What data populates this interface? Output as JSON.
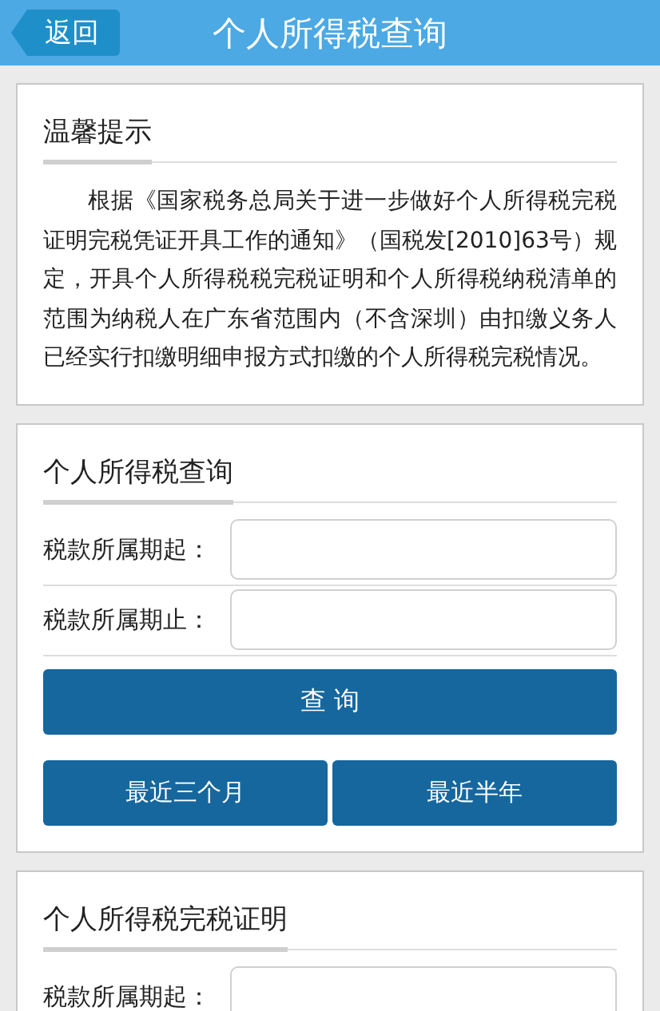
{
  "header": {
    "back_button": "返回",
    "title": "个人所得税查询"
  },
  "notice": {
    "heading": "温馨提示",
    "body": "根据《国家税务总局关于进一步做好个人所得税完税证明完税凭证开具工作的通知》（国税发[2010]63号）规定，开具个人所得税税完税证明和个人所得税纳税清单的范围为纳税人在广东省范围内（不含深圳）由扣缴义务人已经实行扣缴明细申报方式扣缴的个人所得税完税情况。"
  },
  "query": {
    "heading": "个人所得税查询",
    "fields": [
      {
        "label": "税款所属期起："
      },
      {
        "label": "税款所属期止："
      }
    ],
    "submit_button": "查 询",
    "quick_buttons": [
      "最近三个月",
      "最近半年"
    ]
  },
  "certificate": {
    "heading": "个人所得税完税证明",
    "fields": [
      {
        "label": "税款所属期起："
      }
    ]
  }
}
